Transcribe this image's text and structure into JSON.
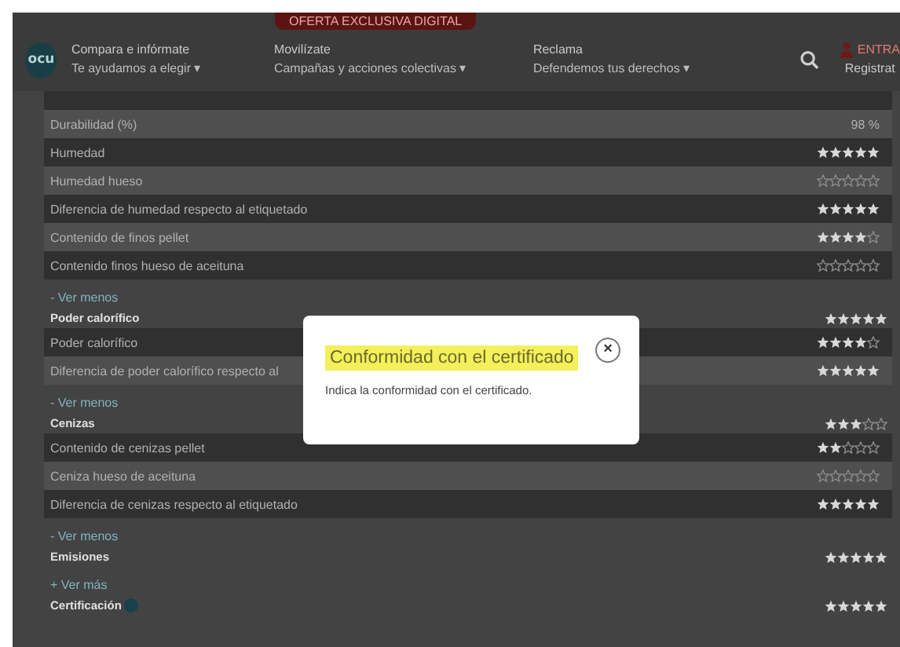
{
  "header": {
    "promo": "OFERTA EXCLUSIVA DIGITAL",
    "logo": "ocu",
    "nav": [
      {
        "title": "Compara e infórmate",
        "subtitle": "Te ayudamos a elegir",
        "caret": "▾"
      },
      {
        "title": "Movilízate",
        "subtitle": "Campañas y acciones colectivas",
        "caret": "▾"
      },
      {
        "title": "Reclama",
        "subtitle": "Defendemos tus derechos",
        "caret": "▾"
      }
    ],
    "login": "ENTRA",
    "register": "Registrat"
  },
  "items": [
    {
      "kind": "row",
      "shaded": true
    },
    {
      "kind": "row",
      "label": "Durabilidad (%)",
      "value": "98 %",
      "shaded": false
    },
    {
      "kind": "row",
      "label": "Humedad",
      "stars": 5,
      "shaded": true
    },
    {
      "kind": "row",
      "label": "Humedad hueso",
      "stars": 0,
      "shaded": false
    },
    {
      "kind": "row",
      "label": "Diferencia de humedad respecto al etiquetado",
      "stars": 5,
      "shaded": true
    },
    {
      "kind": "row",
      "label": "Contenido de finos pellet",
      "stars": 4,
      "shaded": false
    },
    {
      "kind": "row",
      "label": "Contenido finos hueso de aceituna",
      "stars": 0,
      "shaded": true
    },
    {
      "kind": "link",
      "label": "- Ver menos"
    },
    {
      "kind": "group",
      "label": "Poder calorífico",
      "stars": 5
    },
    {
      "kind": "row",
      "label": "Poder calorífico",
      "stars": 4,
      "shaded": true
    },
    {
      "kind": "row",
      "label": "Diferencia de poder calorífico respecto al",
      "stars": 5,
      "shaded": false
    },
    {
      "kind": "link",
      "label": "- Ver menos"
    },
    {
      "kind": "group",
      "label": "Cenizas",
      "stars": 3
    },
    {
      "kind": "row",
      "label": "Contenido de cenizas pellet",
      "stars": 2,
      "shaded": true
    },
    {
      "kind": "row",
      "label": "Ceniza hueso de aceituna",
      "stars": 0,
      "shaded": false
    },
    {
      "kind": "row",
      "label": "Diferencia de cenizas respecto al etiquetado",
      "stars": 5,
      "shaded": true
    },
    {
      "kind": "link",
      "label": "- Ver menos"
    },
    {
      "kind": "group",
      "label": "Emisiones",
      "stars": 5
    },
    {
      "kind": "link",
      "label": "+ Ver más"
    },
    {
      "kind": "group",
      "label": "Certificación",
      "stars": 5,
      "info": true
    }
  ],
  "modal": {
    "title": "Conformidad con el certificado",
    "text": "Indica la conformidad con el certificado.",
    "close": "×"
  }
}
